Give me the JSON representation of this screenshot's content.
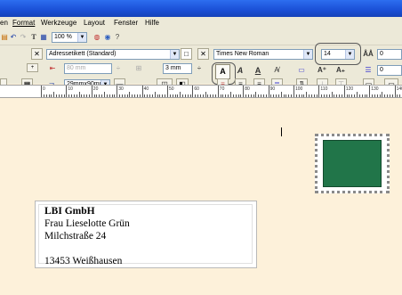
{
  "menu": {
    "items": [
      "en",
      "Format",
      "Werkzeuge",
      "Layout",
      "Fenster",
      "Hilfe"
    ]
  },
  "toolbar_top": {
    "zoom": "100 %"
  },
  "toolbar_format": {
    "label_type": "Adressetikett (Standard)",
    "font": "Times New Roman",
    "font_size": "14",
    "spacing_top": "0"
  },
  "toolbar_layout": {
    "width_value": "80 mm",
    "offset_value": "3 mm",
    "size_value": "29mmx90mm",
    "spacing_bottom": "0"
  },
  "ruler": {
    "marks": [
      "0",
      "10",
      "20",
      "30",
      "40",
      "50",
      "60",
      "70",
      "80",
      "90",
      "100",
      "110",
      "120",
      "130",
      "140"
    ]
  },
  "address": {
    "company": "LBI GmbH",
    "name": "Frau Lieselotte Grün",
    "street": "Milchstraße 24",
    "city": "13453 Weißhausen"
  },
  "colors": {
    "stamp": "#217549",
    "title_bar": "#1a4fd6",
    "background": "#fdf1da"
  }
}
